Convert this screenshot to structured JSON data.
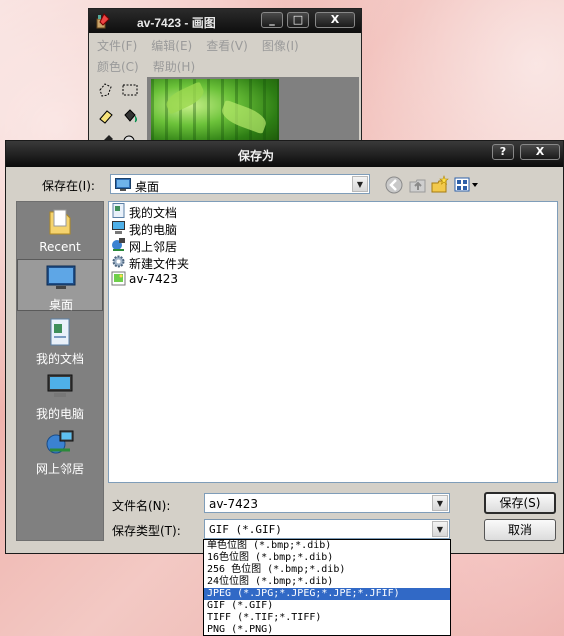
{
  "paint": {
    "title": "av-7423 - 画图",
    "menu": [
      "文件(F)",
      "编辑(E)",
      "查看(V)",
      "图像(I)",
      "颜色(C)",
      "帮助(H)"
    ],
    "btn_min": "_",
    "btn_max": "□",
    "btn_close": "X"
  },
  "dialog": {
    "title": "保存为",
    "help_btn": "?",
    "close_btn": "X",
    "save_in_label": "保存在(I):",
    "save_in_value": "桌面",
    "places": [
      {
        "label": "Recent",
        "icon": "recent-folder-icon"
      },
      {
        "label": "桌面",
        "icon": "desktop-icon"
      },
      {
        "label": "我的文档",
        "icon": "documents-icon"
      },
      {
        "label": "我的电脑",
        "icon": "computer-icon"
      },
      {
        "label": "网上邻居",
        "icon": "network-icon"
      }
    ],
    "files": [
      {
        "name": "我的文档",
        "icon": "documents-icon"
      },
      {
        "name": "我的电脑",
        "icon": "computer-icon"
      },
      {
        "name": "网上邻居",
        "icon": "network-icon"
      },
      {
        "name": "新建文件夹",
        "icon": "gear-folder-icon"
      },
      {
        "name": "av-7423",
        "icon": "image-file-icon"
      }
    ],
    "filename_label": "文件名(N):",
    "filename_value": "av-7423",
    "filetype_label": "保存类型(T):",
    "filetype_value": "GIF (*.GIF)",
    "save_button": "保存(S)",
    "cancel_button": "取消",
    "filetype_options": [
      "单色位图 (*.bmp;*.dib)",
      "16色位图 (*.bmp;*.dib)",
      "256 色位图 (*.bmp;*.dib)",
      "24位位图 (*.bmp;*.dib)",
      "JPEG (*.JPG;*.JPEG;*.JPE;*.JFIF)",
      "GIF (*.GIF)",
      "TIFF (*.TIF;*.TIFF)",
      "PNG (*.PNG)"
    ],
    "highlighted_option": 4,
    "colors": {
      "highlight": "#3169c6",
      "title_bar": "#0b0b0b",
      "dialog_bg": "#d4d0c8"
    }
  }
}
